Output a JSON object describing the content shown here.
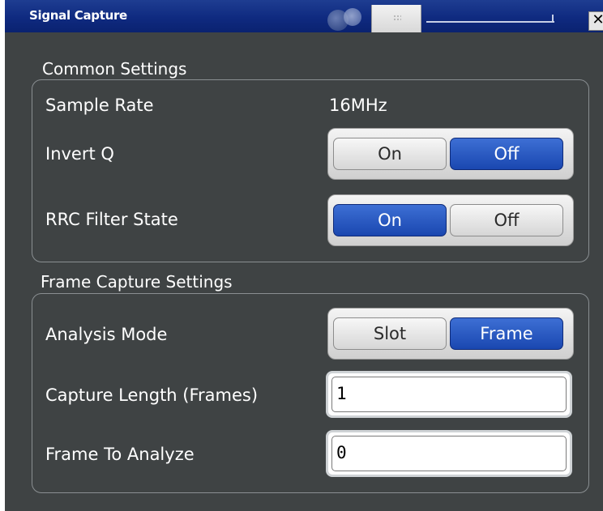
{
  "window": {
    "title": "Signal Capture",
    "close_label": "✕"
  },
  "common_settings": {
    "heading": "Common Settings",
    "sample_rate": {
      "label": "Sample Rate",
      "value": "16MHz"
    },
    "invert_q": {
      "label": "Invert Q",
      "options": [
        "On",
        "Off"
      ],
      "selected": "Off"
    },
    "rrc_filter_state": {
      "label": "RRC Filter State",
      "options": [
        "On",
        "Off"
      ],
      "selected": "On"
    }
  },
  "frame_capture_settings": {
    "heading": "Frame Capture Settings",
    "analysis_mode": {
      "label": "Analysis Mode",
      "options": [
        "Slot",
        "Frame"
      ],
      "selected": "Frame"
    },
    "capture_length": {
      "label": "Capture Length (Frames)",
      "value": "1"
    },
    "frame_to_analyze": {
      "label": "Frame To Analyze",
      "value": "0"
    }
  },
  "colors": {
    "accent_blue": "#1a47b0",
    "panel_bg": "#3f4344",
    "title_bar": "#0f2a80"
  }
}
